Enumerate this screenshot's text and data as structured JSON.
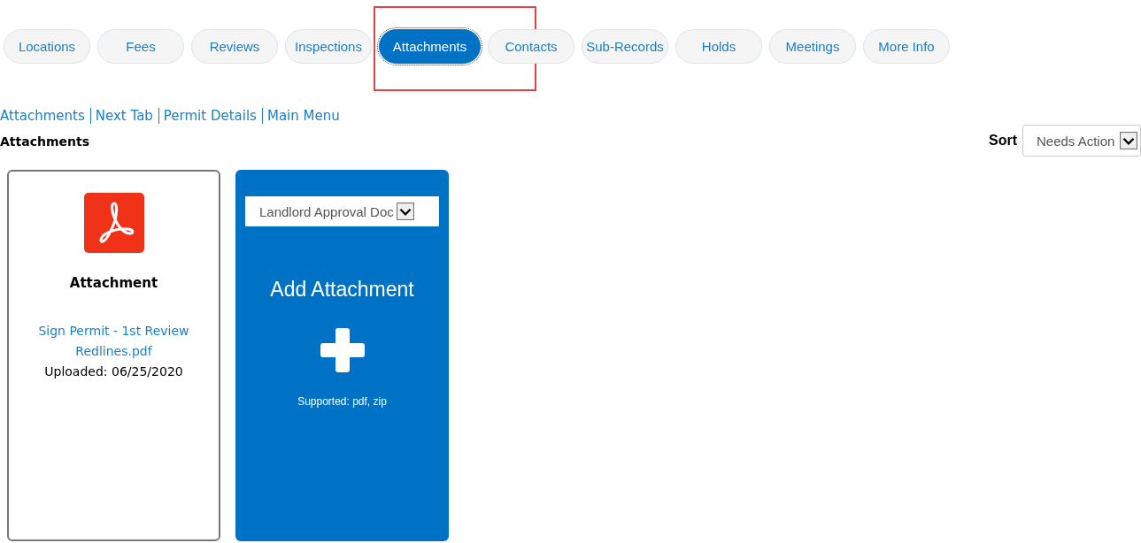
{
  "tabs": [
    {
      "label": "Locations",
      "selected": false,
      "highlighted": false
    },
    {
      "label": "Fees",
      "selected": false,
      "highlighted": false
    },
    {
      "label": "Reviews",
      "selected": false,
      "highlighted": false
    },
    {
      "label": "Inspections",
      "selected": false,
      "highlighted": false
    },
    {
      "label": "Attachments",
      "selected": true,
      "highlighted": true
    },
    {
      "label": "Contacts",
      "selected": false,
      "highlighted": false
    },
    {
      "label": "Sub-Records",
      "selected": false,
      "highlighted": false
    },
    {
      "label": "Holds",
      "selected": false,
      "highlighted": false
    },
    {
      "label": "Meetings",
      "selected": false,
      "highlighted": false
    },
    {
      "label": "More Info",
      "selected": false,
      "highlighted": false
    }
  ],
  "breadcrumb_links": [
    "Attachments",
    "Next Tab",
    "Permit Details",
    "Main Menu"
  ],
  "heading": "Attachments",
  "sort": {
    "label": "Sort",
    "value": "Needs Action"
  },
  "attachments": [
    {
      "title": "Attachment",
      "file_name": "Sign Permit - 1st Review Redlines.pdf",
      "uploaded": "Uploaded: 06/25/2020"
    }
  ],
  "add_card": {
    "document_type": "Landlord Approval Doc",
    "title": "Add Attachment",
    "supported": "Supported: pdf, zip"
  }
}
